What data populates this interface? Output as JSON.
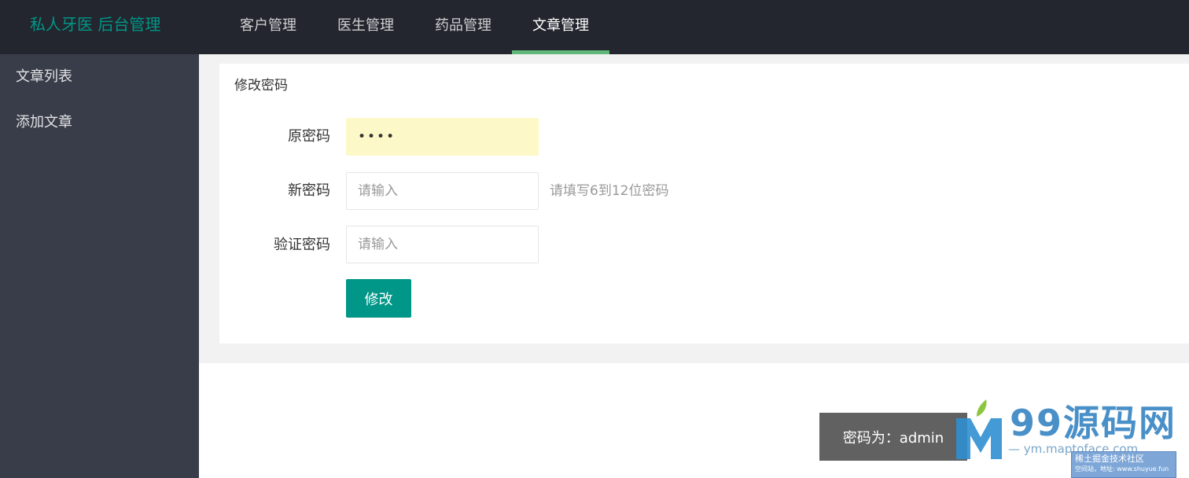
{
  "header": {
    "logo": "私人牙医 后台管理",
    "nav": [
      {
        "label": "客户管理",
        "active": false
      },
      {
        "label": "医生管理",
        "active": false
      },
      {
        "label": "药品管理",
        "active": false
      },
      {
        "label": "文章管理",
        "active": true
      }
    ]
  },
  "sidebar": {
    "items": [
      {
        "label": "文章列表"
      },
      {
        "label": "添加文章"
      }
    ]
  },
  "form": {
    "title": "修改密码",
    "old_password": {
      "label": "原密码",
      "value": "••••"
    },
    "new_password": {
      "label": "新密码",
      "placeholder": "请输入",
      "tip": "请填写6到12位密码"
    },
    "confirm_password": {
      "label": "验证密码",
      "placeholder": "请输入"
    },
    "submit_label": "修改"
  },
  "tooltip": {
    "text": "密码为：admin"
  },
  "watermark": {
    "site_name": "99源码网",
    "url": "— ym.maptoface.com",
    "badge_line1": "稀土掘金技术社区",
    "badge_line2": "空间站，地址: www.shuyue.fun"
  },
  "colors": {
    "header_bg": "#23262e",
    "sidebar_bg": "#393d49",
    "accent": "#009688",
    "active_underline": "#5FB878"
  }
}
